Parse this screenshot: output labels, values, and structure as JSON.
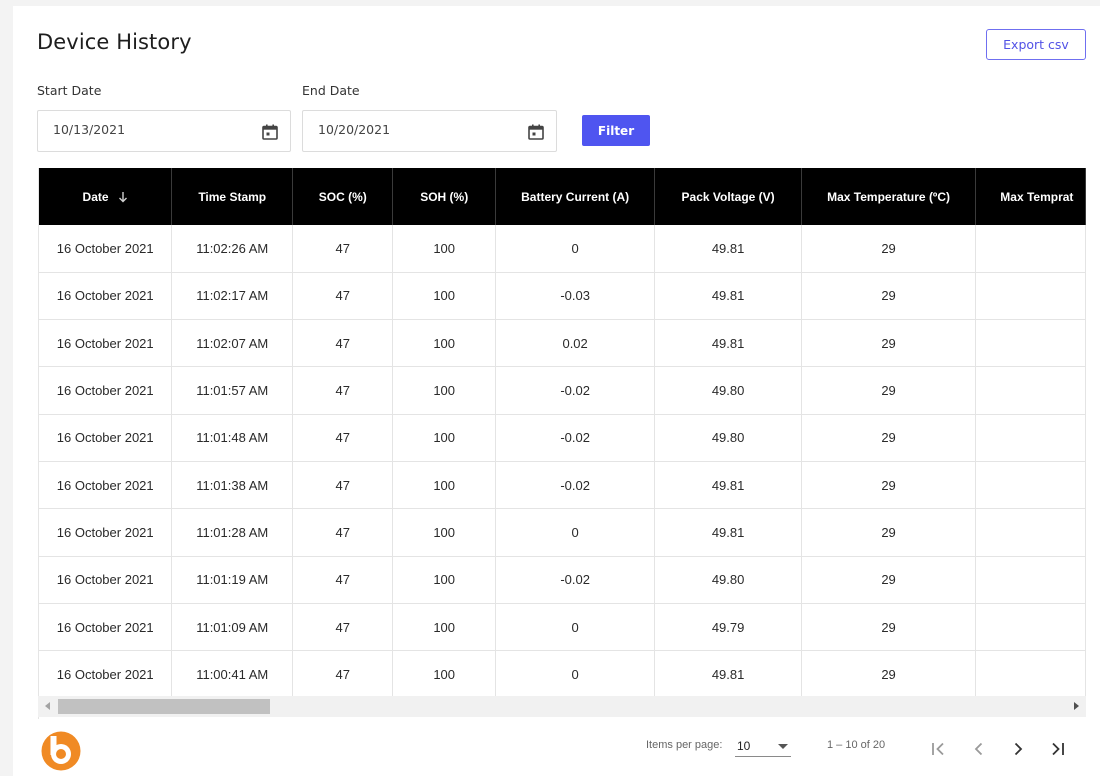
{
  "page": {
    "title": "Device History",
    "export_label": "Export csv",
    "filter_label": "Filter"
  },
  "filters": {
    "start": {
      "label": "Start Date",
      "value": "10/13/2021",
      "icon": "calendar-icon"
    },
    "end": {
      "label": "End Date",
      "value": "10/20/2021",
      "icon": "calendar-icon"
    }
  },
  "table": {
    "columns": [
      {
        "key": "date",
        "label": "Date",
        "sortable": true,
        "sort_icon": "arrow-down-icon"
      },
      {
        "key": "time",
        "label": "Time Stamp"
      },
      {
        "key": "soc",
        "label": "SOC (%)"
      },
      {
        "key": "soh",
        "label": "SOH (%)"
      },
      {
        "key": "current",
        "label": "Battery Current (A)"
      },
      {
        "key": "voltage",
        "label": "Pack Voltage (V)"
      },
      {
        "key": "max_temp",
        "label": "Max Temperature (ºC)"
      },
      {
        "key": "max_temp2",
        "label": "Max Temprat"
      }
    ],
    "rows": [
      [
        "16 October 2021",
        "11:02:26 AM",
        "47",
        "100",
        "0",
        "49.81",
        "29",
        ""
      ],
      [
        "16 October 2021",
        "11:02:17 AM",
        "47",
        "100",
        "-0.03",
        "49.81",
        "29",
        ""
      ],
      [
        "16 October 2021",
        "11:02:07 AM",
        "47",
        "100",
        "0.02",
        "49.81",
        "29",
        ""
      ],
      [
        "16 October 2021",
        "11:01:57 AM",
        "47",
        "100",
        "-0.02",
        "49.80",
        "29",
        ""
      ],
      [
        "16 October 2021",
        "11:01:48 AM",
        "47",
        "100",
        "-0.02",
        "49.80",
        "29",
        ""
      ],
      [
        "16 October 2021",
        "11:01:38 AM",
        "47",
        "100",
        "-0.02",
        "49.81",
        "29",
        ""
      ],
      [
        "16 October 2021",
        "11:01:28 AM",
        "47",
        "100",
        "0",
        "49.81",
        "29",
        ""
      ],
      [
        "16 October 2021",
        "11:01:19 AM",
        "47",
        "100",
        "-0.02",
        "49.80",
        "29",
        ""
      ],
      [
        "16 October 2021",
        "11:01:09 AM",
        "47",
        "100",
        "0",
        "49.79",
        "29",
        ""
      ],
      [
        "16 October 2021",
        "11:00:41 AM",
        "47",
        "100",
        "0",
        "49.81",
        "29",
        ""
      ]
    ]
  },
  "paginator": {
    "items_per_page_label": "Items per page:",
    "items_per_page": "10",
    "range_label": "1 – 10 of 20",
    "buttons": [
      "first-page-icon",
      "prev-page-icon",
      "next-page-icon",
      "last-page-icon"
    ]
  },
  "colors": {
    "accent": "#4f55f0",
    "header_bg": "#000000",
    "logo_orange": "#f08a24"
  }
}
